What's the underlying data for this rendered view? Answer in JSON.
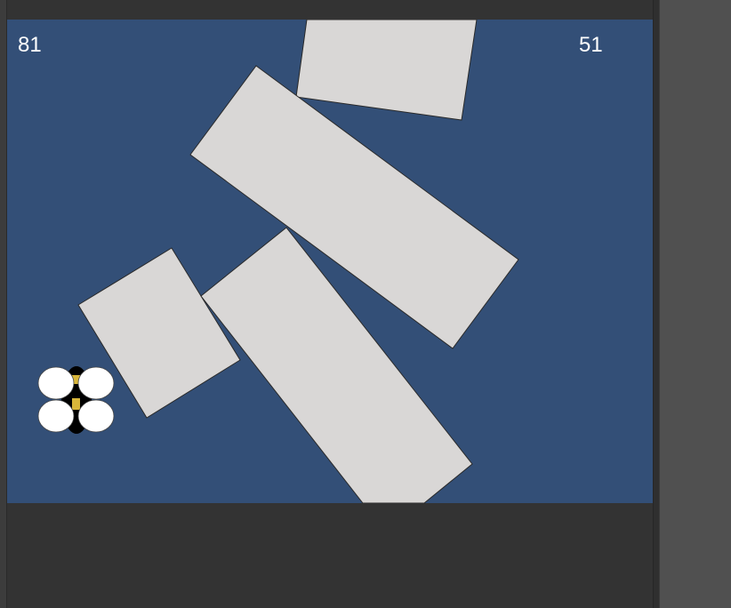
{
  "game": {
    "score_left": "81",
    "score_right": "51",
    "background_color": "#334f77",
    "block_color": "#d9d7d6",
    "player_icon": "bee-icon"
  }
}
